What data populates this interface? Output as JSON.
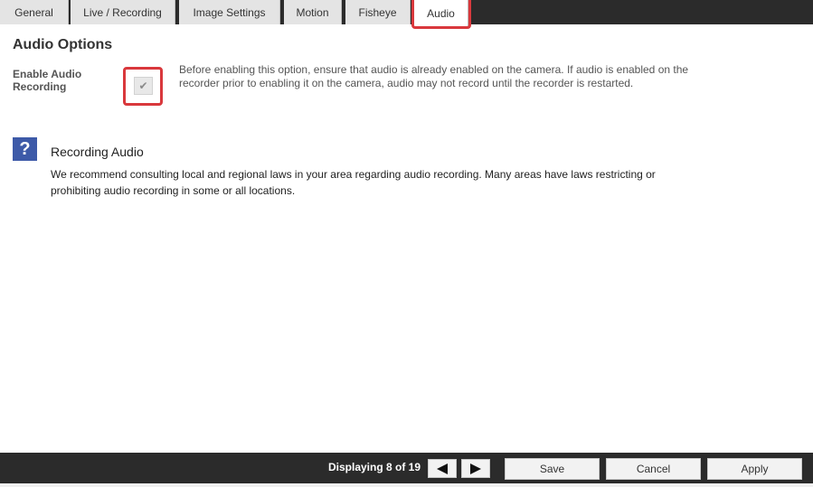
{
  "tabs": [
    {
      "label": "General"
    },
    {
      "label": "Live / Recording"
    },
    {
      "label": "Image Settings"
    },
    {
      "label": "Motion"
    },
    {
      "label": "Fisheye"
    },
    {
      "label": "Audio",
      "active": true
    }
  ],
  "section": {
    "title": "Audio Options"
  },
  "option": {
    "label": "Enable Audio Recording",
    "checked": true,
    "check_glyph": "✔",
    "description": "Before enabling this option, ensure that audio is already enabled on the camera. If audio is enabled on the recorder prior to enabling it on the camera, audio may not record until the recorder is restarted."
  },
  "help": {
    "icon_glyph": "?",
    "icon": "question-icon",
    "title": "Recording Audio",
    "text": "We recommend consulting local and regional laws in your area regarding audio recording. Many areas have laws restricting or prohibiting audio recording in some or all locations."
  },
  "footer": {
    "display_count": "Displaying 8 of 19",
    "save_label": "Save",
    "cancel_label": "Cancel",
    "apply_label": "Apply"
  },
  "colors": {
    "highlight": "#d9383c",
    "help_icon_bg": "#3d5aa8",
    "bar_bg": "#2b2b2b"
  }
}
